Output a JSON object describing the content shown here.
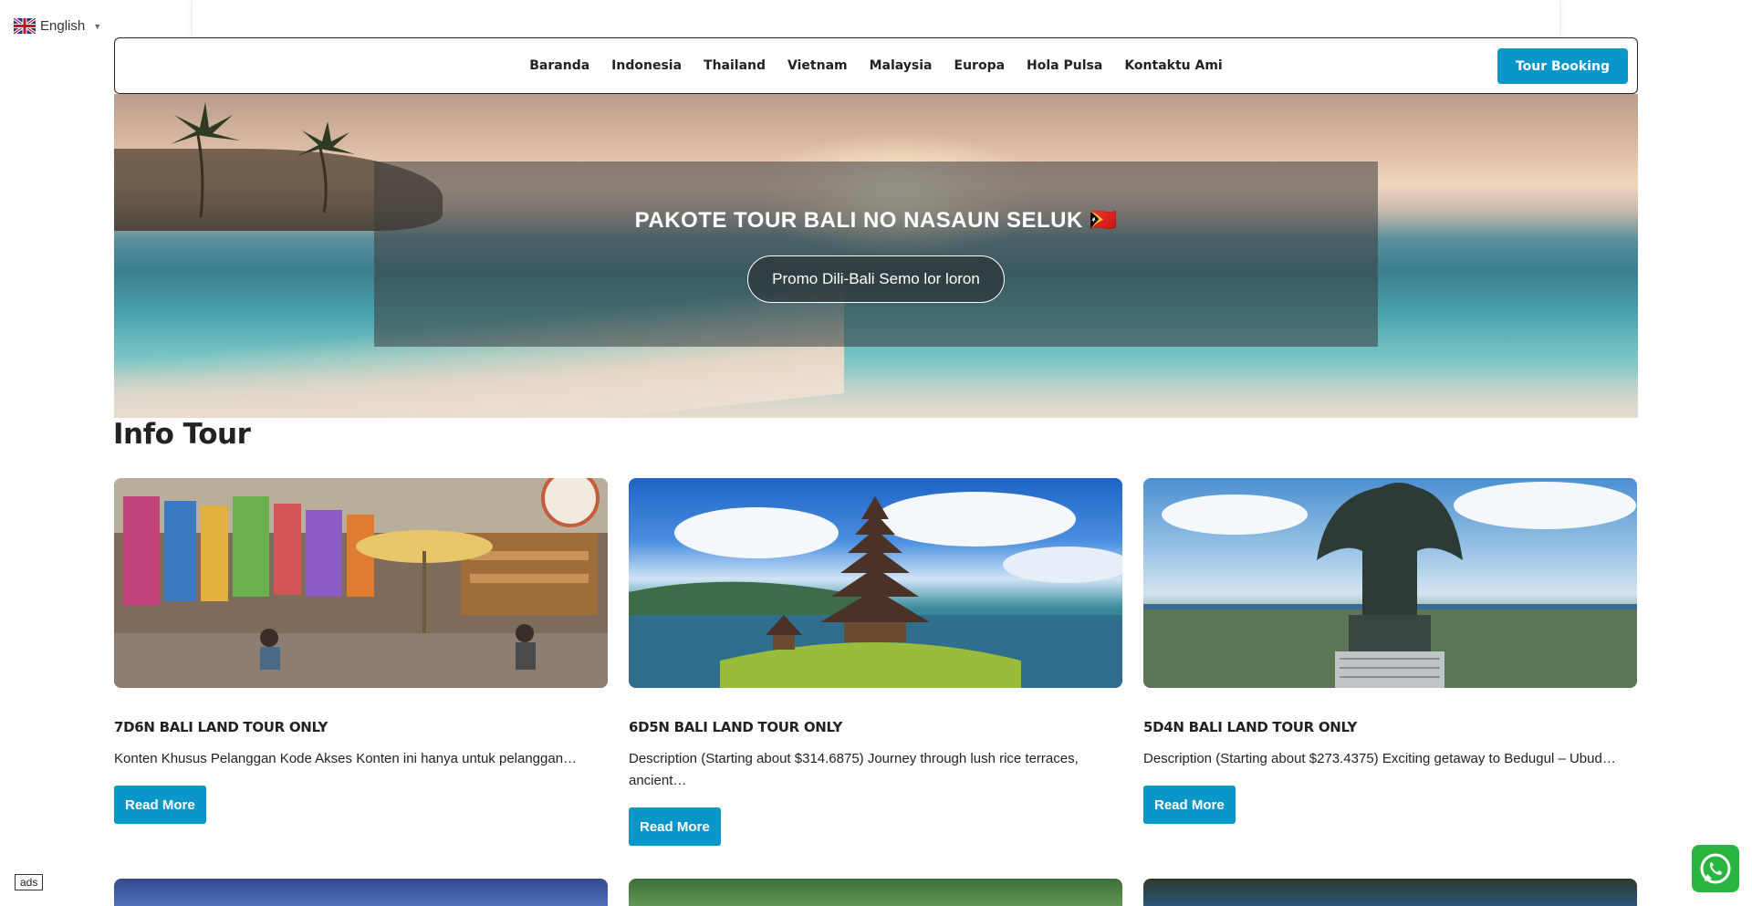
{
  "language": {
    "label": "English",
    "icon": "uk-flag-icon"
  },
  "nav": {
    "items": [
      "Baranda",
      "Indonesia",
      "Thailand",
      "Vietnam",
      "Malaysia",
      "Europa",
      "Hola Pulsa",
      "Kontaktu Ami"
    ],
    "cta": "Tour Booking"
  },
  "hero": {
    "title": "PAKOTE TOUR BALI NO NASAUN SELUK 🇹🇱",
    "button": "Promo Dili-Bali Semo lor loron"
  },
  "section": {
    "title": "Info Tour"
  },
  "cards": [
    {
      "title": "7D6N BALI LAND TOUR ONLY",
      "desc": "Konten Khusus Pelanggan Kode Akses Konten ini hanya untuk pelanggan…",
      "button": "Read More"
    },
    {
      "title": "6D5N BALI LAND TOUR ONLY",
      "desc": "Description (Starting about $314.6875) Journey through lush rice terraces, ancient…",
      "button": "Read More"
    },
    {
      "title": "5D4N BALI LAND TOUR ONLY",
      "desc": "Description (Starting about $273.4375) Exciting getaway to Bedugul – Ubud…",
      "button": "Read More"
    }
  ],
  "ads_label": "ads",
  "whatsapp_icon": "whatsapp-icon",
  "colors": {
    "accent": "#0a96c8",
    "whatsapp": "#2ab540"
  }
}
